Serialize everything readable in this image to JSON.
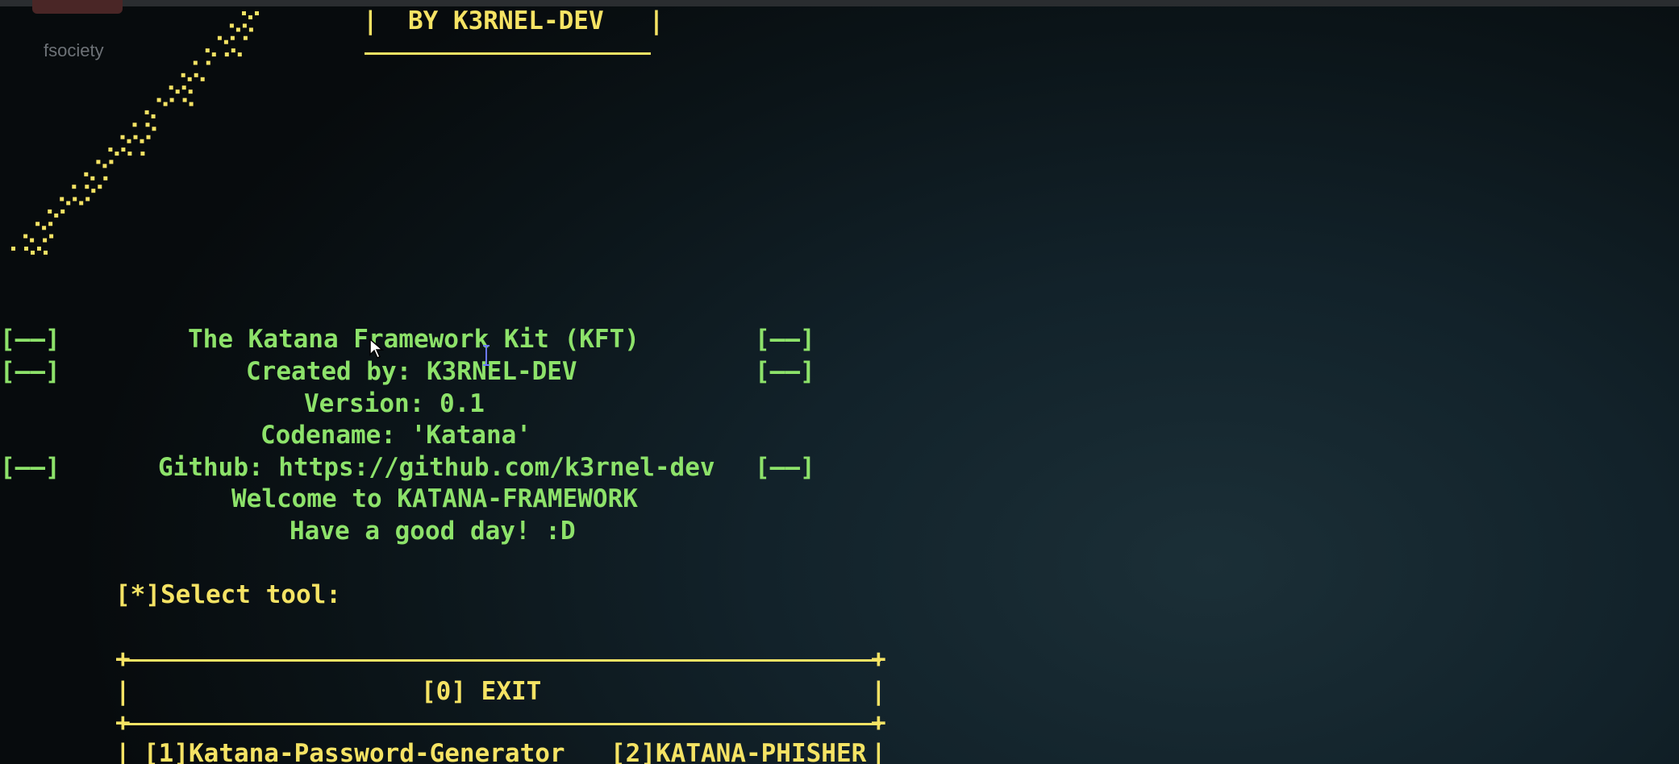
{
  "window": {
    "tab_label": "fsociety"
  },
  "banner": {
    "credit": "|  BY K3RNEL-DEV   |"
  },
  "info": {
    "side_tag": "[——]",
    "title": "The Katana Framework Kit (KFT)",
    "created_by": "Created by: K3RNEL-DEV",
    "version": "Version: 0.1",
    "codename": "Codename: 'Katana'",
    "github": "Github: https://github.com/k3rnel-dev",
    "welcome": "Welcome to KATANA-FRAMEWORK",
    "farewell": "Have a good day! :D"
  },
  "menu": {
    "prompt": "[*]Select tool:",
    "exit_option": "[0] EXIT",
    "tools": [
      {
        "label": "[1]Katana-Password-Generator"
      },
      {
        "label": "[2]KATANA-PHISHER"
      }
    ]
  },
  "colors": {
    "terminal_yellow": "#f5e364",
    "terminal_green": "#8de26a",
    "background": "#0f1c22"
  },
  "icons": [
    "mouse-pointer-icon",
    "text-cursor-icon"
  ]
}
